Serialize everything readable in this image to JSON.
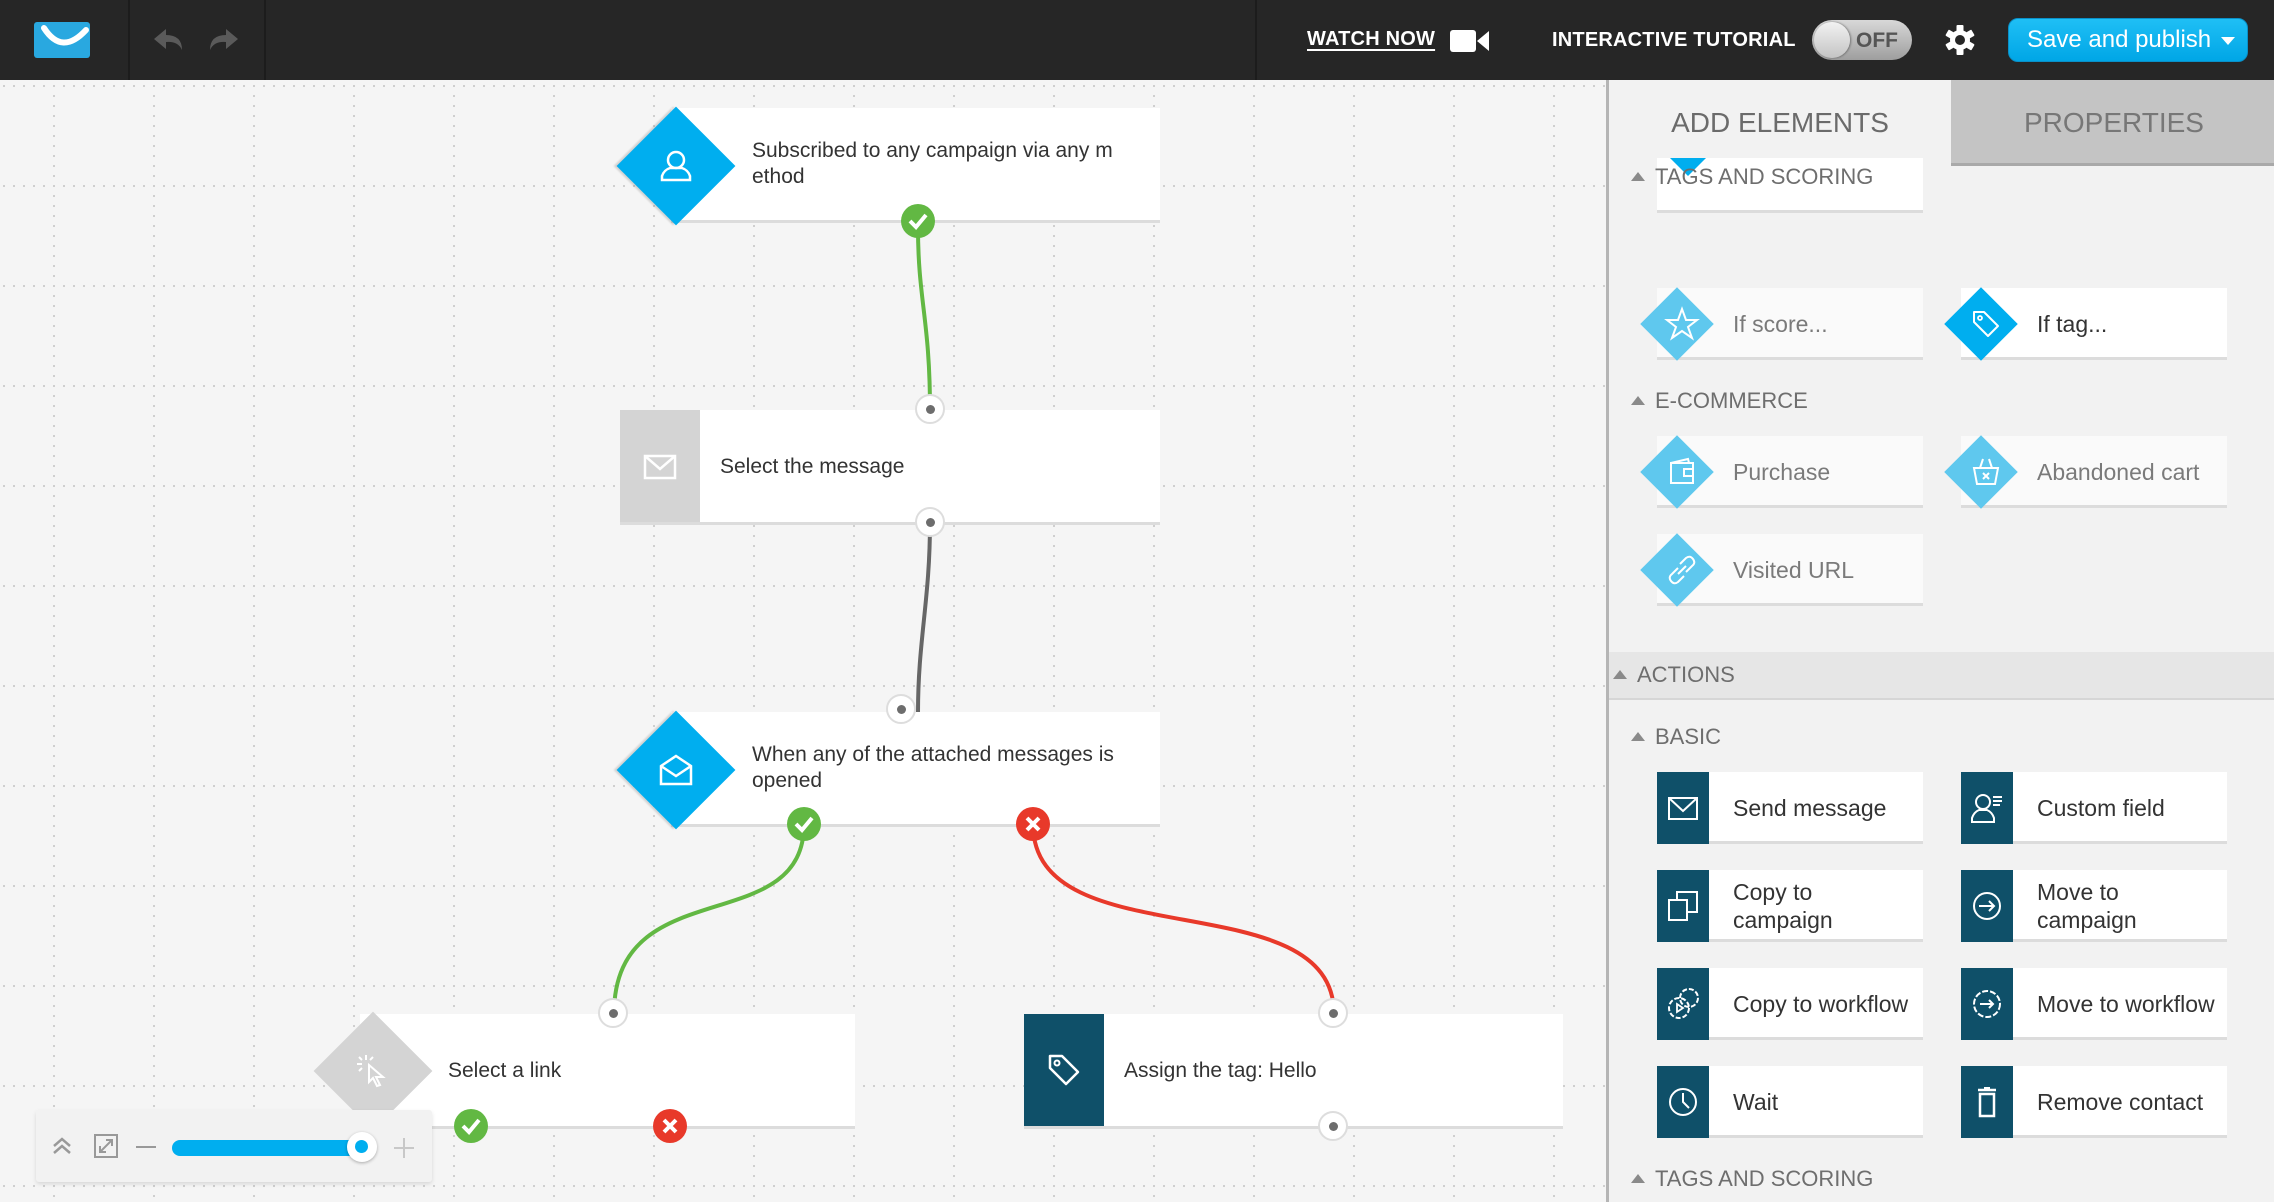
{
  "topbar": {
    "logo": "getresponse-logo",
    "undo_icon": "undo-icon",
    "redo_icon": "redo-icon",
    "watch_now": "WATCH NOW",
    "interactive_tutorial": "INTERACTIVE TUTORIAL",
    "tutorial_toggle": "OFF",
    "save_publish": "Save and publish"
  },
  "canvas": {
    "nodes": [
      {
        "id": "subscribed",
        "type": "condition",
        "icon": "user-icon",
        "label": "Subscribed to any campaign via any m\nethod"
      },
      {
        "id": "select-message",
        "type": "action-placeholder",
        "icon": "envelope-icon",
        "label": "Select the message"
      },
      {
        "id": "message-opened",
        "type": "condition",
        "icon": "open-envelope-icon",
        "label": "When any of the attached messages is opened"
      },
      {
        "id": "select-link",
        "type": "condition-placeholder",
        "icon": "cursor-click-icon",
        "label": "Select a link"
      },
      {
        "id": "assign-tag",
        "type": "action",
        "icon": "tag-icon",
        "label": "Assign the tag: Hello"
      }
    ],
    "connections": [
      {
        "from": "subscribed",
        "branch": "yes",
        "to": "select-message"
      },
      {
        "from": "select-message",
        "branch": "next",
        "to": "message-opened"
      },
      {
        "from": "message-opened",
        "branch": "yes",
        "to": "select-link"
      },
      {
        "from": "message-opened",
        "branch": "no",
        "to": "assign-tag"
      }
    ],
    "zoom": {
      "level_percent": 95
    }
  },
  "panel": {
    "tabs": [
      {
        "label": "ADD ELEMENTS",
        "active": true
      },
      {
        "label": "PROPERTIES",
        "active": false
      }
    ],
    "sections": {
      "tags_scoring_1": "TAGS AND SCORING",
      "ecommerce": "E-COMMERCE",
      "actions": "ACTIONS",
      "basic": "BASIC",
      "tags_scoring_2": "TAGS AND SCORING"
    },
    "conditions": {
      "if_score": "If score...",
      "if_tag": "If tag...",
      "purchase": "Purchase",
      "abandoned_cart": "Abandoned cart",
      "visited_url": "Visited URL"
    },
    "actions": {
      "send_message": "Send message",
      "custom_field": "Custom field",
      "copy_to_campaign": "Copy to campaign",
      "move_to_campaign": "Move to campaign",
      "copy_to_workflow": "Copy to workflow",
      "move_to_workflow": "Move to workflow",
      "wait": "Wait",
      "remove_contact": "Remove contact"
    }
  },
  "colors": {
    "brand_blue": "#00aeef",
    "condition_faded": "#5fc8ee",
    "action_teal": "#0f5069",
    "yes_green": "#62b843",
    "no_red": "#e8392a",
    "placeholder_grey": "#d4d4d4"
  }
}
